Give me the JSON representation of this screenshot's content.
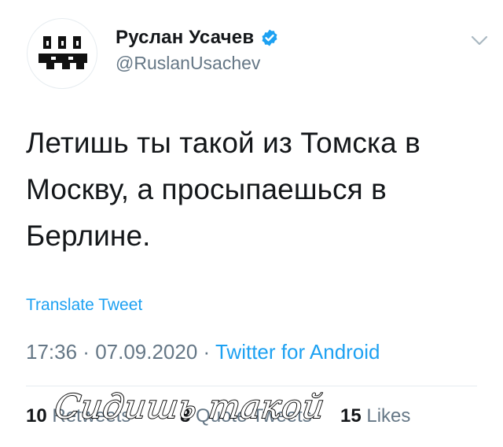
{
  "author": {
    "display_name": "Руслан Усачев",
    "handle": "@RuslanUsachev",
    "verified": true,
    "verified_color": "#1da1f2"
  },
  "tweet": {
    "text": "Летишь ты такой из Томска в\nМоскву, а просыпаешься в\nБерлине.",
    "translate_label": "Translate Tweet",
    "time": "17:36",
    "date": "07.09.2020",
    "source": "Twitter for Android",
    "separator": " · "
  },
  "stats": {
    "retweets": {
      "count": "10",
      "label": "Retweets"
    },
    "quote_tweets": {
      "count": "8",
      "label": "Quote Tweets"
    },
    "likes": {
      "count": "15",
      "label": "Likes"
    }
  },
  "overlay": {
    "caption": "Сидишь такой"
  },
  "colors": {
    "accent": "#1da1f2",
    "text": "#14171a",
    "secondary": "#657786",
    "divider": "#e6ecf0"
  },
  "icons": {
    "avatar": "pixel-logo-avatar",
    "verified": "verified-badge-icon",
    "more": "chevron-down-icon"
  }
}
